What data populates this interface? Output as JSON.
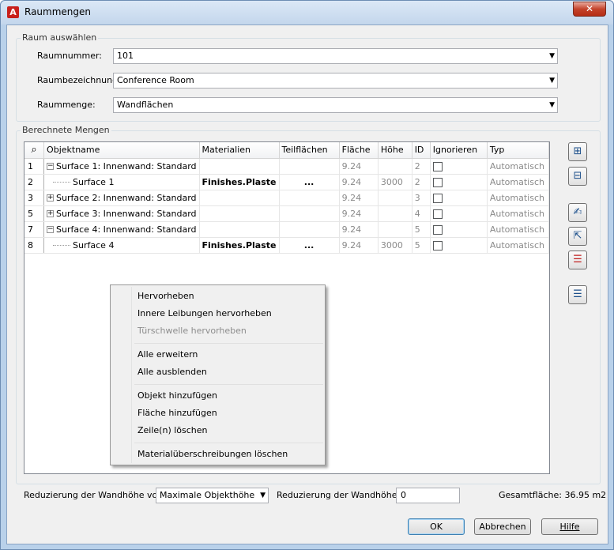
{
  "window": {
    "title": "Raummengen",
    "close_glyph": "✕",
    "app_icon": "autocad-app-icon"
  },
  "select_group": {
    "label": "Raum auswählen",
    "room_number": {
      "label": "Raumnummer:",
      "value": "101"
    },
    "room_name": {
      "label": "Raumbezeichnung:",
      "value": "Conference Room"
    },
    "room_quantity": {
      "label": "Raummenge:",
      "value": "Wandflächen"
    }
  },
  "calc_group": {
    "label": "Berechnete Mengen",
    "columns": [
      "Objektname",
      "Materialien",
      "Teilflächen",
      "Fläche",
      "Höhe",
      "ID",
      "Ignorieren",
      "Typ"
    ],
    "rows": [
      {
        "num": "1",
        "expander": "−",
        "name": "Surface 1: Innenwand: Standard",
        "material": "",
        "sub": "",
        "area": "9.24",
        "height": "",
        "id": "2",
        "type": "Automatisch",
        "child": false
      },
      {
        "num": "2",
        "expander": "",
        "name": "Surface 1",
        "material": "Finishes.Plaste",
        "sub": "...",
        "area": "9.24",
        "height": "3000",
        "id": "2",
        "type": "Automatisch",
        "child": true
      },
      {
        "num": "3",
        "expander": "+",
        "name": "Surface 2: Innenwand: Standard",
        "material": "",
        "sub": "",
        "area": "9.24",
        "height": "",
        "id": "3",
        "type": "Automatisch",
        "child": false
      },
      {
        "num": "5",
        "expander": "+",
        "name": "Surface 3: Innenwand: Standard",
        "material": "",
        "sub": "",
        "area": "9.24",
        "height": "",
        "id": "4",
        "type": "Automatisch",
        "child": false
      },
      {
        "num": "7",
        "expander": "−",
        "name": "Surface 4: Innenwand: Standard",
        "material": "",
        "sub": "",
        "area": "9.24",
        "height": "",
        "id": "5",
        "type": "Automatisch",
        "child": false
      },
      {
        "num": "8",
        "expander": "",
        "name": "Surface 4",
        "material": "Finishes.Plaste",
        "sub": "...",
        "area": "9.24",
        "height": "3000",
        "id": "5",
        "type": "Automatisch",
        "child": true
      }
    ]
  },
  "context_menu": {
    "items": [
      {
        "label": "Hervorheben",
        "enabled": true
      },
      {
        "label": "Innere Leibungen hervorheben",
        "enabled": true
      },
      {
        "label": "Türschwelle hervorheben",
        "enabled": false
      },
      {
        "label": "Alle erweitern",
        "enabled": true
      },
      {
        "label": "Alle ausblenden",
        "enabled": true
      },
      {
        "label": "Objekt hinzufügen",
        "enabled": true
      },
      {
        "label": "Fläche hinzufügen",
        "enabled": true
      },
      {
        "label": "Zeile(n) löschen",
        "enabled": true
      },
      {
        "label": "Materialüberschreibungen löschen",
        "enabled": true
      }
    ]
  },
  "toolbar": {
    "icons": [
      "expand-all-icon",
      "collapse-all-icon",
      "highlight-icon",
      "select-object-icon",
      "delete-rows-icon",
      "material-list-icon"
    ],
    "glyphs": [
      "⊞",
      "⊟",
      "✍",
      "⇱",
      "☰",
      "☰"
    ]
  },
  "footer": {
    "reduce_from_label": "Reduzierung der Wandhöhe von",
    "reduce_from_value": "Maximale Objekthöhe",
    "reduce_label": "Reduzierung der Wandhöhe",
    "reduce_value": "0",
    "total_area": "Gesamtfläche: 36.95 m2"
  },
  "buttons": {
    "ok": "OK",
    "cancel": "Abbrechen",
    "help": "Hilfe"
  }
}
